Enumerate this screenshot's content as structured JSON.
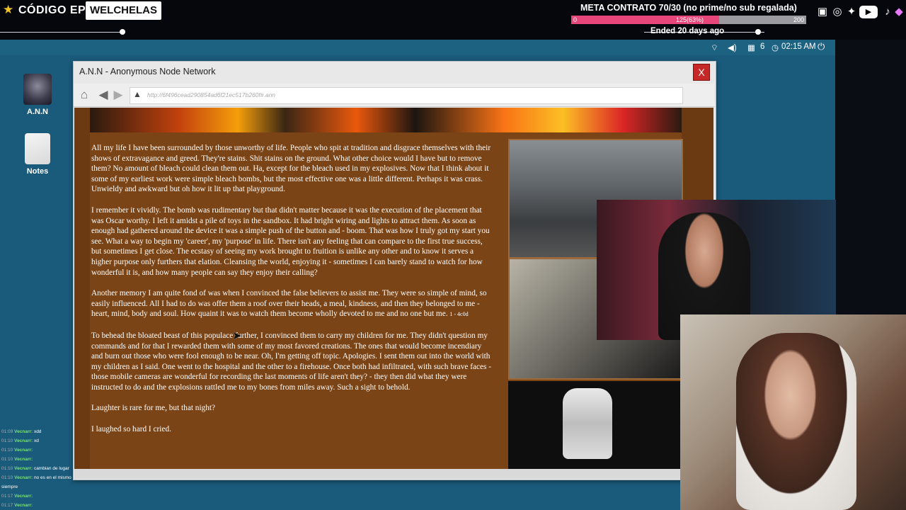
{
  "overlay": {
    "brand": "CÓDIGO EPIC",
    "brand2": "WELCHELAS",
    "goal_title": "META CONTRATO 70/30 (no prime/no sub regalada)",
    "goal_min": "0",
    "goal_pct_label": "125(63%)",
    "goal_max": "200",
    "goal_progress": 0.63,
    "goal_status": "Ended 20 days ago",
    "social_icons": [
      "twitch-icon",
      "instagram-icon",
      "twitter-icon",
      "youtube-icon",
      "tiktok-icon",
      "discord-icon"
    ]
  },
  "tray": {
    "count": "6",
    "clock": "02:15 AM"
  },
  "desktop_icons": [
    {
      "label": "A.N.N"
    },
    {
      "label": "Notes"
    }
  ],
  "window": {
    "title": "A.N.N - Anonymous Node Network",
    "close_label": "X",
    "url": "http://6f496cead290854ad6f21ec517b260f#.ann"
  },
  "story": {
    "p1": "All my life I have been surrounded by those unworthy of life. People who spit at tradition and disgrace themselves with their shows of extravagance and greed. They're stains. Shit stains on the ground. What other choice would I have but to remove them? No amount of bleach could clean them out. Ha, except for the bleach used in my explosives. Now that I think about it some of my earliest work were simple bleach bombs, but the most effective one was a little different. Perhaps it was crass. Unwieldy and awkward but oh how it lit up that playground.",
    "p2": "I remember it vividly. The bomb was rudimentary but that didn't matter because it was the execution of the placement that was Oscar worthy. I left it amidst a pile of toys in the sandbox. It had bright wiring and lights to attract them. As soon as enough had gathered around the device it was a simple push of the button and - boom. That was how I truly got my start you see. What a way to begin my 'career', my 'purpose' in life. There isn't any feeling that can compare to the first true success, but sometimes I get close. The ecstasy of seeing my work brought to fruition is unlike any other and to know it serves a higher purpose only furthers that elation. Cleansing the world, enjoying it - sometimes I can barely stand to watch for how wonderful it is, and how many people can say they enjoy their calling?",
    "p3": "Another memory I am quite fond of was when I convinced the false believers to assist me. They were so simple of mind, so easily influenced. All I had to do was offer them a roof over their heads, a meal, kindness, and then they belonged to me - heart, mind, body and soul. How quaint it was to watch them become wholly devoted to me and no one but me.",
    "p3_code": "1 - 4c0d",
    "p4": "To behead the bloated beast of this populace further, I convinced them to carry my children for me. They didn't question my commands and for that I rewarded them with some of my most favored creations. The ones that would become incendiary and burn out those who were fool enough to be near. Oh, I'm getting off topic. Apologies. I sent them out into the world with my children as I said. One went to the hospital and the other to a firehouse. Once both had infiltrated, with such brave faces - those mobile cameras are wonderful for recording the last moments of life aren't they? - they then did what they were instructed to do and the explosions rattled me to my bones from miles away. Such a sight to behold.",
    "p5": "Laughter is rare for me, but that night?",
    "p6": "I laughed so hard I cried."
  },
  "chat": [
    {
      "time": "01:09",
      "user": "Vecnarr:",
      "msg": "xdd"
    },
    {
      "time": "01:10",
      "user": "Vecnarr:",
      "msg": "xd"
    },
    {
      "time": "01:10",
      "user": "Vecnarr:",
      "msg": ""
    },
    {
      "time": "01:10",
      "user": "Vecnarr:",
      "msg": ""
    },
    {
      "time": "01:10",
      "user": "Vecnarr:",
      "msg": "cambian de lugar"
    },
    {
      "time": "01:10",
      "user": "Vecnarr:",
      "msg": "no es en el mismo"
    },
    {
      "time": "",
      "user": "",
      "msg": "siempre"
    },
    {
      "time": "01:17",
      "user": "Vecnarr:",
      "msg": ""
    },
    {
      "time": "01:17",
      "user": "Vecnarr:",
      "msg": ""
    }
  ],
  "colors": {
    "goal_fill": "#e7467a",
    "page_bg": "#7a4416",
    "desktop_bg": "#1a5a7a",
    "close_btn": "#c62828"
  }
}
